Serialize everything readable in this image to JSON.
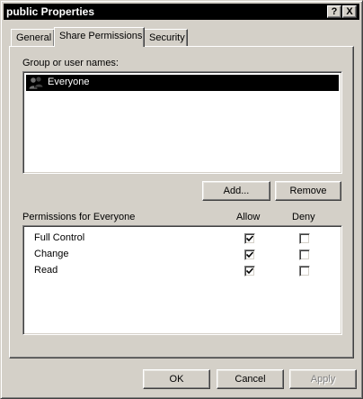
{
  "window": {
    "title": "public Properties",
    "help_label": "?",
    "close_label": "X"
  },
  "tabs": [
    {
      "label": "General",
      "selected": false
    },
    {
      "label": "Share Permissions",
      "selected": true
    },
    {
      "label": "Security",
      "selected": false
    }
  ],
  "users_section": {
    "label": "Group or user names:",
    "users": [
      {
        "name": "Everyone",
        "icon": "user-group-icon",
        "selected": true
      }
    ],
    "add_label": "Add...",
    "remove_label": "Remove"
  },
  "permissions_section": {
    "label": "Permissions for Everyone",
    "allow_header": "Allow",
    "deny_header": "Deny",
    "rows": [
      {
        "name": "Full Control",
        "allow": true,
        "deny": false
      },
      {
        "name": "Change",
        "allow": true,
        "deny": false
      },
      {
        "name": "Read",
        "allow": true,
        "deny": false
      }
    ]
  },
  "footer": {
    "ok_label": "OK",
    "cancel_label": "Cancel",
    "apply_label": "Apply",
    "apply_disabled": true
  },
  "colors": {
    "face": "#d4d0c8",
    "selection": "#000000",
    "titlebar": "#000000"
  }
}
